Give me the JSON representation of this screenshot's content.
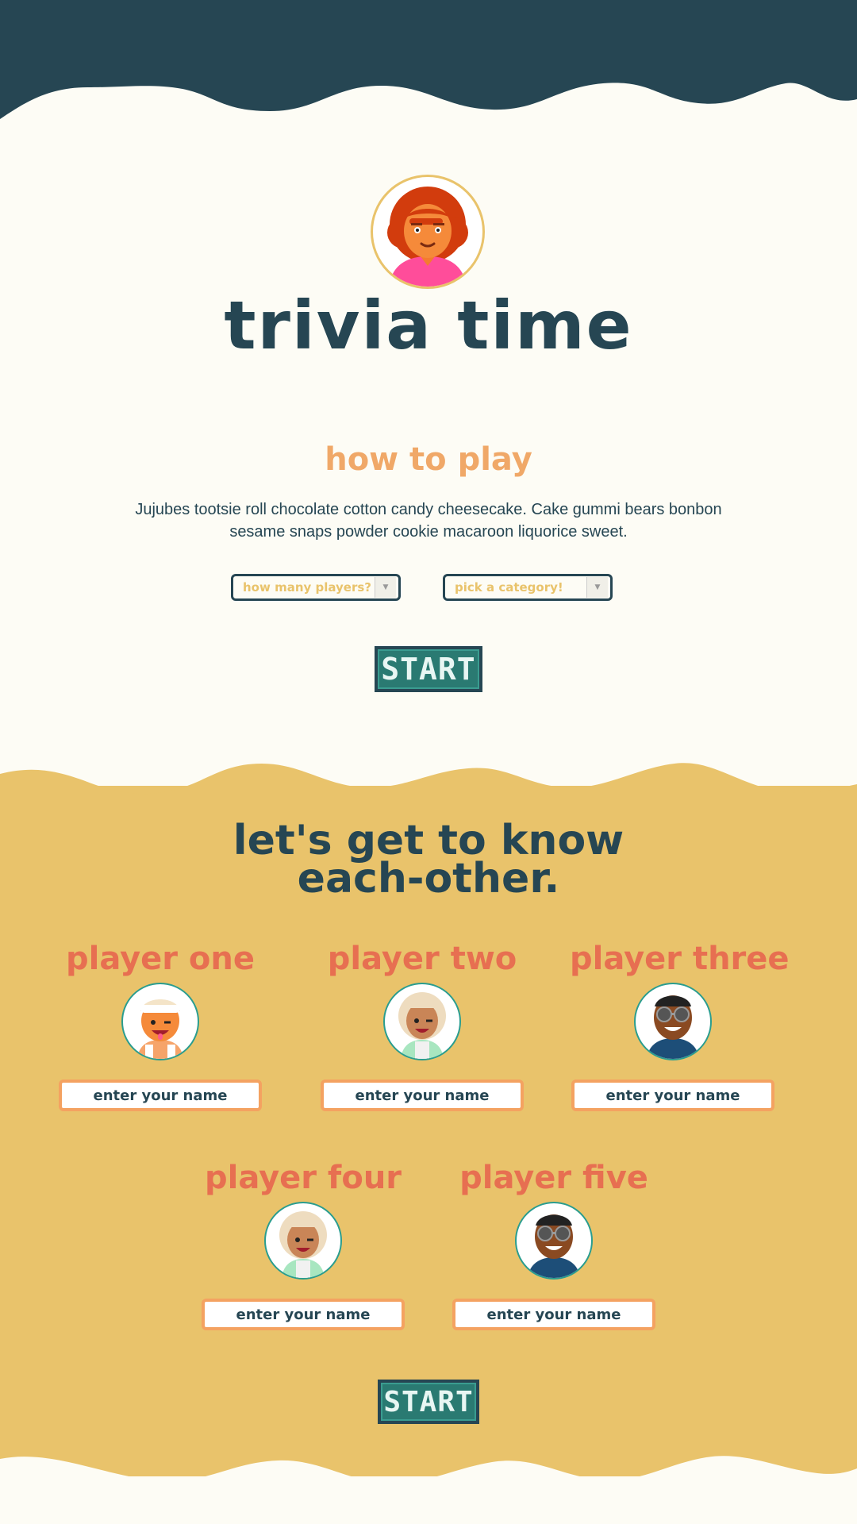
{
  "app": {
    "title": "trivia time"
  },
  "colors": {
    "navy": "#264653",
    "cream": "#fdfcf5",
    "mustard": "#e9c36b",
    "orange": "#f0a868",
    "coral": "#e76f51",
    "teal": "#2a7a72"
  },
  "how_to_play": {
    "heading": "how to play",
    "description": "Jujubes tootsie roll chocolate cotton candy cheesecake. Cake gummi bears bonbon sesame snaps powder cookie macaroon liquorice sweet."
  },
  "controls": {
    "players_select": "how many players?",
    "category_select": "pick a category!",
    "start_label": "START"
  },
  "players_section": {
    "heading_line1": "let's get to know",
    "heading_line2": "each-other.",
    "input_placeholder": "enter your name",
    "players": [
      {
        "label": "player one",
        "avatar": "avatar-girl-headband"
      },
      {
        "label": "player two",
        "avatar": "avatar-woman-wink"
      },
      {
        "label": "player three",
        "avatar": "avatar-man-sunglasses"
      },
      {
        "label": "player four",
        "avatar": "avatar-woman-wink"
      },
      {
        "label": "player five",
        "avatar": "avatar-man-sunglasses"
      }
    ],
    "start_label": "START"
  }
}
